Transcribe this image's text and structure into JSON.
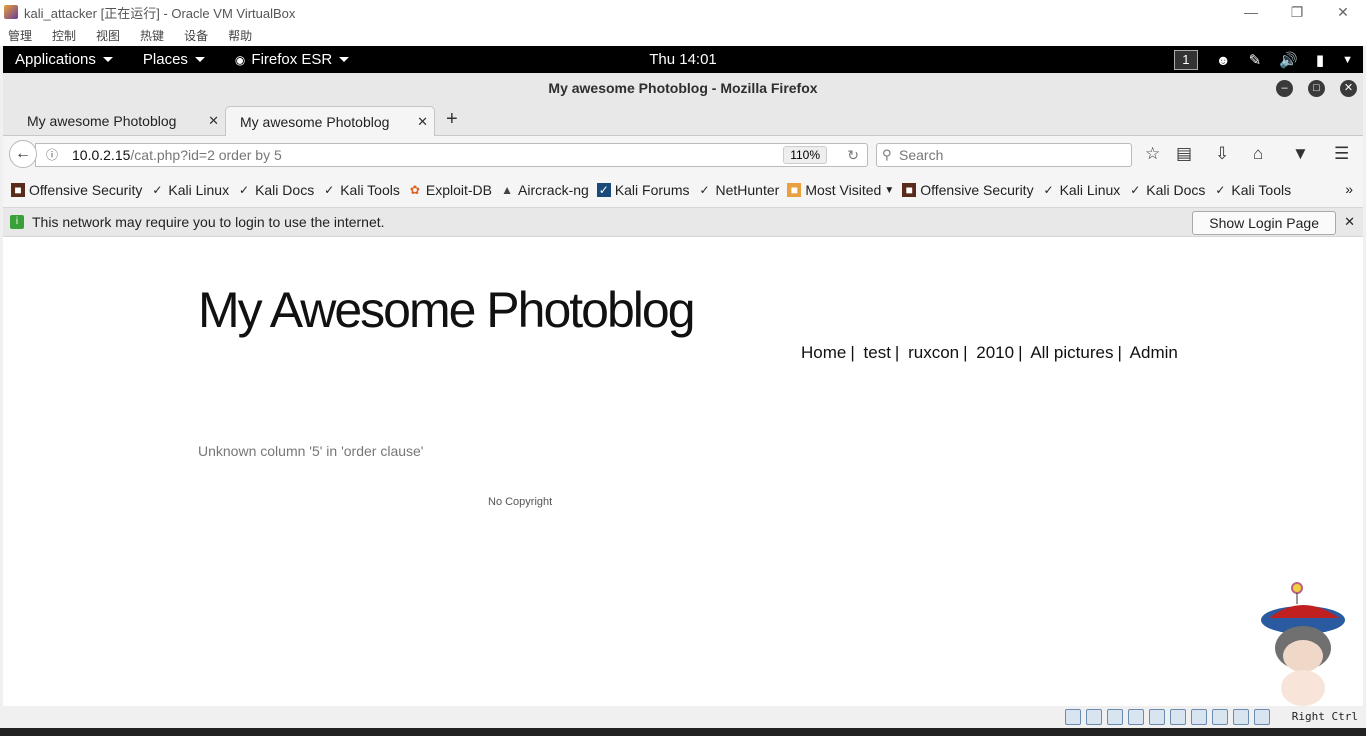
{
  "vbox": {
    "title": "kali_attacker [正在运行] - Oracle VM VirtualBox",
    "menu": [
      "管理",
      "控制",
      "视图",
      "热键",
      "设备",
      "帮助"
    ],
    "host_key": "Right Ctrl"
  },
  "gnome": {
    "applications": "Applications",
    "places": "Places",
    "app": "Firefox ESR",
    "clock": "Thu 14:01",
    "workspace": "1"
  },
  "firefox": {
    "window_title": "My awesome Photoblog - Mozilla Firefox",
    "tabs": [
      {
        "label": "My awesome Photoblog"
      },
      {
        "label": "My awesome Photoblog"
      }
    ],
    "url_host": "10.0.2.15",
    "url_path": "/cat.php?id=2 order by 5",
    "zoom": "110%",
    "search_placeholder": "Search",
    "bookmarks": [
      {
        "label": "Offensive Security",
        "icon": "offsec-icon"
      },
      {
        "label": "Kali Linux",
        "icon": "kali-dragon-icon"
      },
      {
        "label": "Kali Docs",
        "icon": "kali-dragon-icon"
      },
      {
        "label": "Kali Tools",
        "icon": "kali-dragon-icon"
      },
      {
        "label": "Exploit-DB",
        "icon": "exploitdb-icon"
      },
      {
        "label": "Aircrack-ng",
        "icon": "aircrack-icon"
      },
      {
        "label": "Kali Forums",
        "icon": "kali-forums-icon"
      },
      {
        "label": "NetHunter",
        "icon": "kali-dragon-icon"
      },
      {
        "label": "Most Visited",
        "icon": "folder-icon"
      },
      {
        "label": "Offensive Security",
        "icon": "offsec-icon"
      },
      {
        "label": "Kali Linux",
        "icon": "kali-dragon-icon"
      },
      {
        "label": "Kali Docs",
        "icon": "kali-dragon-icon"
      },
      {
        "label": "Kali Tools",
        "icon": "kali-dragon-icon"
      }
    ],
    "notification": "This network may require you to login to use the internet.",
    "notification_button": "Show Login Page"
  },
  "page": {
    "title": "My Awesome Photoblog",
    "nav": [
      "Home",
      "test",
      "ruxcon",
      "2010",
      "All pictures",
      "Admin"
    ],
    "error": "Unknown column '5' in 'order clause'",
    "footer": "No Copyright"
  }
}
